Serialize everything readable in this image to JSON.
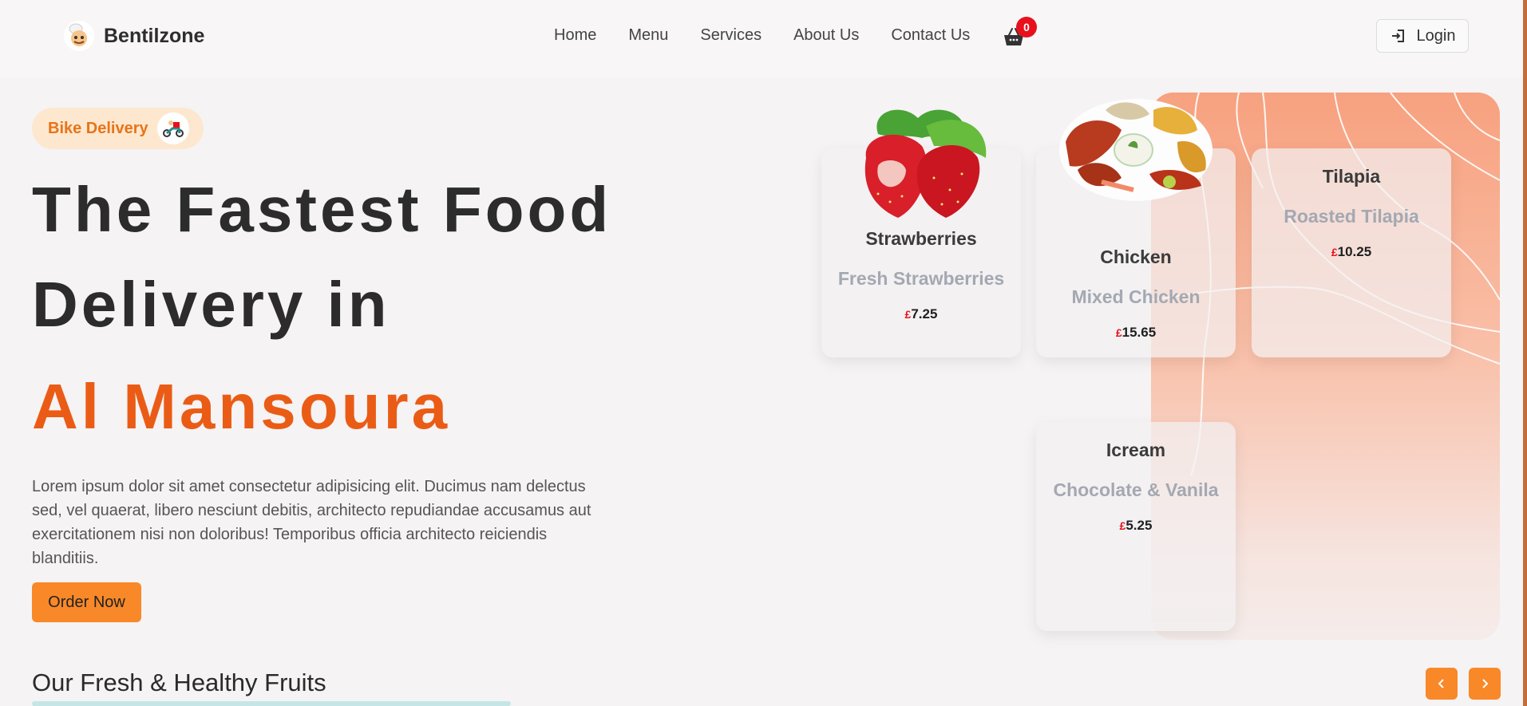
{
  "header": {
    "brand_name": "Bentilzone",
    "nav": [
      "Home",
      "Menu",
      "Services",
      "About Us",
      "Contact Us"
    ],
    "cart_count": "0",
    "login_label": "Login"
  },
  "hero": {
    "badge": "Bike Delivery",
    "title_line1": "The Fastest Food",
    "title_line2": "Delivery in",
    "title_line3": "Al Mansoura",
    "description": "Lorem ipsum dolor sit amet consectetur adipisicing elit. Ducimus nam delectus sed, vel quaerat, libero nesciunt debitis, architecto repudiandae accusamus aut exercitationem nisi non doloribus! Temporibus officia architecto reiciendis blanditiis.",
    "order_button": "Order Now"
  },
  "cards": [
    {
      "title": "Strawberries",
      "subtitle": "Fresh Strawberries",
      "currency": "£",
      "price": "7.25"
    },
    {
      "title": "Chicken",
      "subtitle": "Mixed Chicken",
      "currency": "£",
      "price": "15.65"
    },
    {
      "title": "Tilapia",
      "subtitle": "Roasted Tilapia",
      "currency": "£",
      "price": "10.25"
    },
    {
      "title": "Icream",
      "subtitle": "Chocolate & Vanila",
      "currency": "£",
      "price": "5.25"
    }
  ],
  "fruits_section": {
    "title": "Our Fresh & Healthy Fruits"
  },
  "colors": {
    "accent_orange": "#f98828",
    "hero_orange": "#ea5c16",
    "badge_bg": "#fde8cf",
    "cart_badge": "#e8101d"
  }
}
